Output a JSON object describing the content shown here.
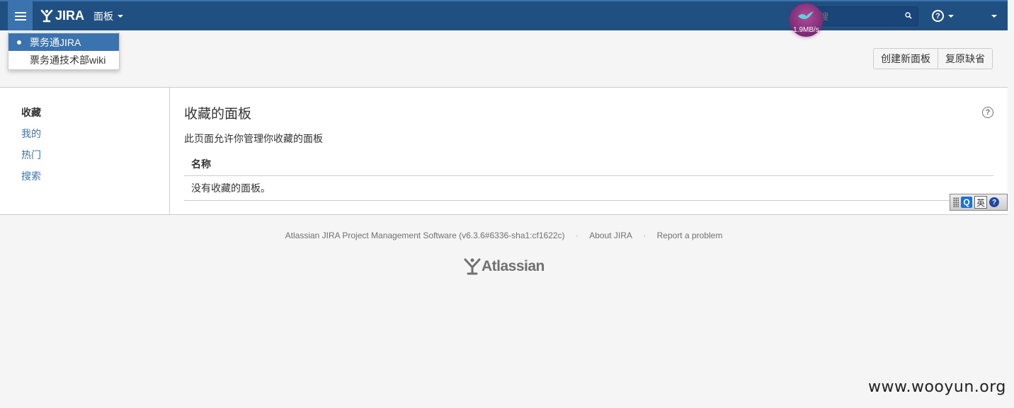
{
  "header": {
    "logo_text": "JIRA",
    "nav_boards": "面板",
    "search_placeholder": "搜",
    "help_glyph": "?",
    "speed": "1.9MB/s"
  },
  "app_switcher": {
    "items": [
      {
        "label": "票务通JIRA",
        "active": true
      },
      {
        "label": "票务通技术部wiki",
        "active": false
      }
    ]
  },
  "actions": {
    "create": "创建新面板",
    "restore": "复原缺省"
  },
  "sidebar": {
    "items": [
      {
        "label": "收藏",
        "selected": true
      },
      {
        "label": "我的",
        "selected": false
      },
      {
        "label": "热门",
        "selected": false
      },
      {
        "label": "搜索",
        "selected": false
      }
    ]
  },
  "main": {
    "title": "收藏的面板",
    "description": "此页面允许你管理你收藏的面板",
    "column_name": "名称",
    "empty_message": "没有收藏的面板。",
    "help_glyph": "?"
  },
  "ime": {
    "q": "Q",
    "lang": "英",
    "help": "?"
  },
  "footer": {
    "software": "Atlassian JIRA Project Management Software (v6.3.6#6336-sha1:cf1622c)",
    "about": "About JIRA",
    "report": "Report a problem",
    "separator": "·",
    "atlassian_logo": "Atlassian"
  },
  "watermark": "www.wooyun.org",
  "colors": {
    "header_bg": "#205081",
    "accent": "#3b73af",
    "page_bg": "#f5f5f5"
  }
}
